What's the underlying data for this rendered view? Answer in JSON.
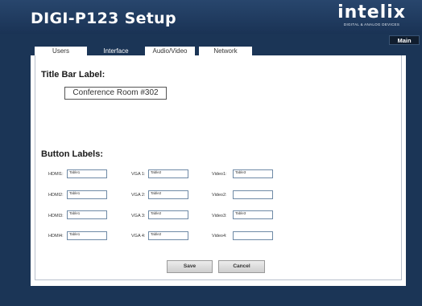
{
  "header": {
    "title": "DIGI-P123 Setup",
    "logo_word": "intelix",
    "logo_tagline": "DIGITAL & ANALOG DEVICES",
    "main_button": "Main"
  },
  "tabs": [
    {
      "label": "Users",
      "active": false
    },
    {
      "label": "Interface",
      "active": true
    },
    {
      "label": "Audio/Video",
      "active": false
    },
    {
      "label": "Network",
      "active": false
    }
  ],
  "title_bar": {
    "heading": "Title Bar Label:",
    "value": "Conference Room #302"
  },
  "button_labels": {
    "heading": "Button Labels:",
    "hdmi": [
      {
        "label": "HDMI1:",
        "value": "Table1"
      },
      {
        "label": "HDMI2:",
        "value": "Table1"
      },
      {
        "label": "HDMI3:",
        "value": "Table1"
      },
      {
        "label": "HDMI4:",
        "value": "Table1"
      }
    ],
    "vga": [
      {
        "label": "VGA 1:",
        "value": "Table2"
      },
      {
        "label": "VGA 2:",
        "value": "Table2"
      },
      {
        "label": "VGA 3:",
        "value": "Table2"
      },
      {
        "label": "VGA 4:",
        "value": "Table2"
      }
    ],
    "video": [
      {
        "label": "Video1:",
        "value": "Table3"
      },
      {
        "label": "Video2:",
        "value": ""
      },
      {
        "label": "Video3:",
        "value": "Table3"
      },
      {
        "label": "Video4:",
        "value": ""
      }
    ]
  },
  "actions": {
    "save": "Save",
    "cancel": "Cancel"
  },
  "colors": {
    "background": "#1b3556",
    "panel": "#ffffff",
    "input_border": "#6f8aa6"
  }
}
